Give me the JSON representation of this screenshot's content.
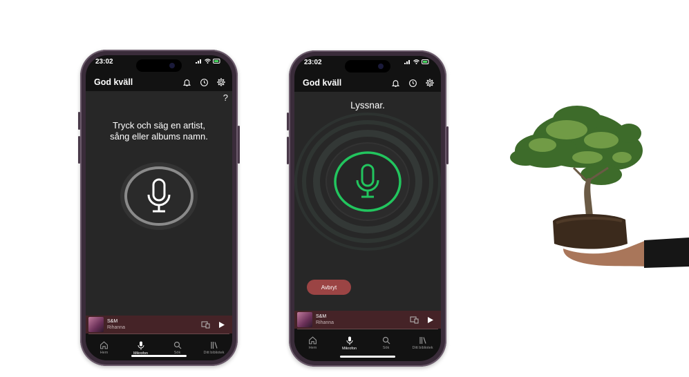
{
  "phones": [
    {
      "status_time": "23:02",
      "greeting": "God kväll",
      "help_symbol": "?",
      "prompt": "Tryck och säg en artist,\nsång eller albums namn.",
      "player": {
        "title": "S&M",
        "artist": "Rihanna"
      },
      "nav": [
        "Hem",
        "Mikrofon",
        "Sök",
        "Ditt bibliotek"
      ]
    },
    {
      "status_time": "23:02",
      "greeting": "God kväll",
      "listening": "Lyssnar.",
      "cancel_label": "Avbryt",
      "player": {
        "title": "S&M",
        "artist": "Rihanna"
      },
      "nav": [
        "Hem",
        "Mikrofon",
        "Sök",
        "Ditt bibliotek"
      ]
    }
  ],
  "colors": {
    "accent_green": "#22c55e",
    "cancel_red": "#9b4444",
    "player_bg": "#452327"
  },
  "icons": [
    "bell-icon",
    "history-icon",
    "gear-icon",
    "microphone-icon",
    "devices-icon",
    "play-icon",
    "home-icon",
    "search-icon",
    "library-icon"
  ]
}
